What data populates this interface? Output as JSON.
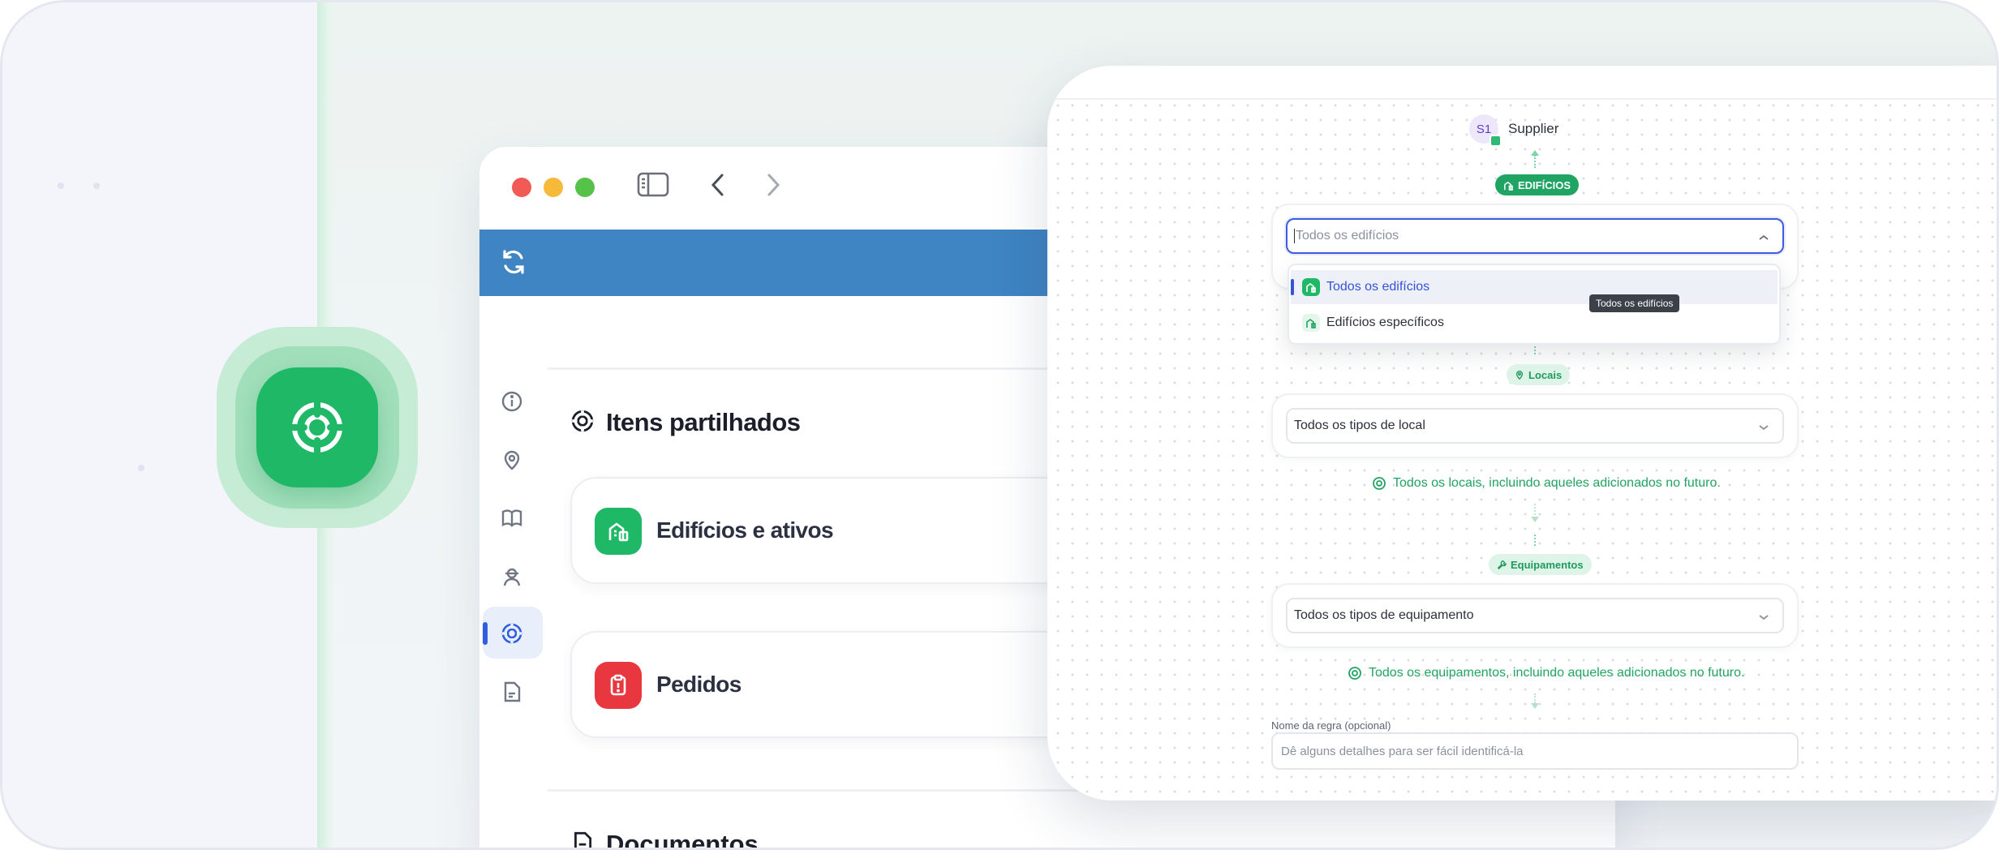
{
  "sidebar_nav": {
    "items": [
      "info-icon",
      "location-pin-icon",
      "book-icon",
      "user-icon",
      "shared-items-icon",
      "document-icon"
    ],
    "active_item": "shared-items-icon"
  },
  "main": {
    "section_title": "Itens partilhados",
    "cards": [
      {
        "label": "Edifícios e ativos",
        "icon": "building-icon",
        "color": "#1fb866"
      },
      {
        "label": "Pedidos",
        "icon": "clipboard-icon",
        "color": "#e9373f"
      }
    ],
    "next_section_title": "Documentos"
  },
  "panel": {
    "supplier": {
      "initials": "S1",
      "name": "Supplier"
    },
    "buildings": {
      "pill": "EDIFÍCIOS",
      "select_placeholder": "Todos os edifícios",
      "options": [
        {
          "label": "Todos os edifícios",
          "highlighted": true
        },
        {
          "label": "Edifícios específicos",
          "highlighted": false
        }
      ],
      "tooltip": "Todos os edifícios"
    },
    "locations": {
      "pill": "Locais",
      "select_value": "Todos os tipos de local",
      "note": "Todos os locais, incluindo aqueles adicionados no futuro."
    },
    "equipment": {
      "pill": "Equipamentos",
      "select_value": "Todos os tipos de equipamento",
      "note": "Todos os equipamentos, incluindo aqueles adicionados no futuro."
    },
    "rule_name": {
      "label": "Nome da regra (opcional)",
      "placeholder": "Dê alguns detalhes para ser fácil identificá-la"
    }
  },
  "colors": {
    "brand_green": "#1fb866",
    "header_blue": "#3f84c3",
    "accent_blue": "#3552d8",
    "danger_red": "#e9373f"
  }
}
